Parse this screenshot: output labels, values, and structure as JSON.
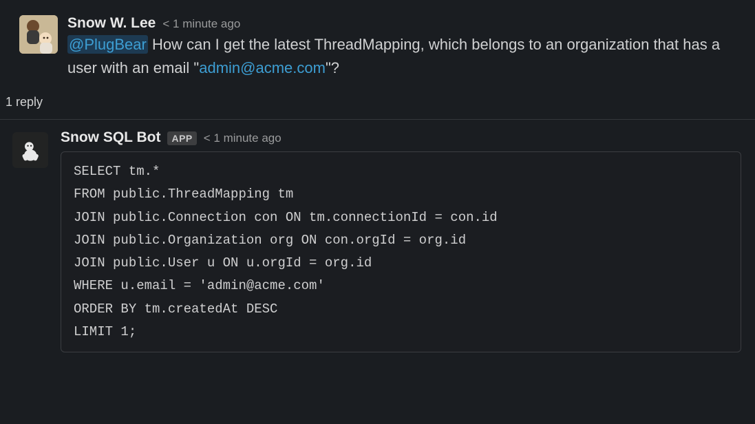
{
  "messages": [
    {
      "author": "Snow W. Lee",
      "timestamp": "< 1 minute ago",
      "mention": "@PlugBear",
      "text_before_mention": "",
      "text_after_mention_1": " How can I get the latest ThreadMapping, which belongs to an organization that has a user with an email \"",
      "email_link": "admin@acme.com",
      "text_after_link": "\"?"
    },
    {
      "author": "Snow SQL Bot",
      "badge": "APP",
      "timestamp": "< 1 minute ago",
      "code": "SELECT tm.*\nFROM public.ThreadMapping tm\nJOIN public.Connection con ON tm.connectionId = con.id\nJOIN public.Organization org ON con.orgId = org.id\nJOIN public.User u ON u.orgId = org.id\nWHERE u.email = 'admin@acme.com'\nORDER BY tm.createdAt DESC\nLIMIT 1;"
    }
  ],
  "reply_count_label": "1 reply"
}
